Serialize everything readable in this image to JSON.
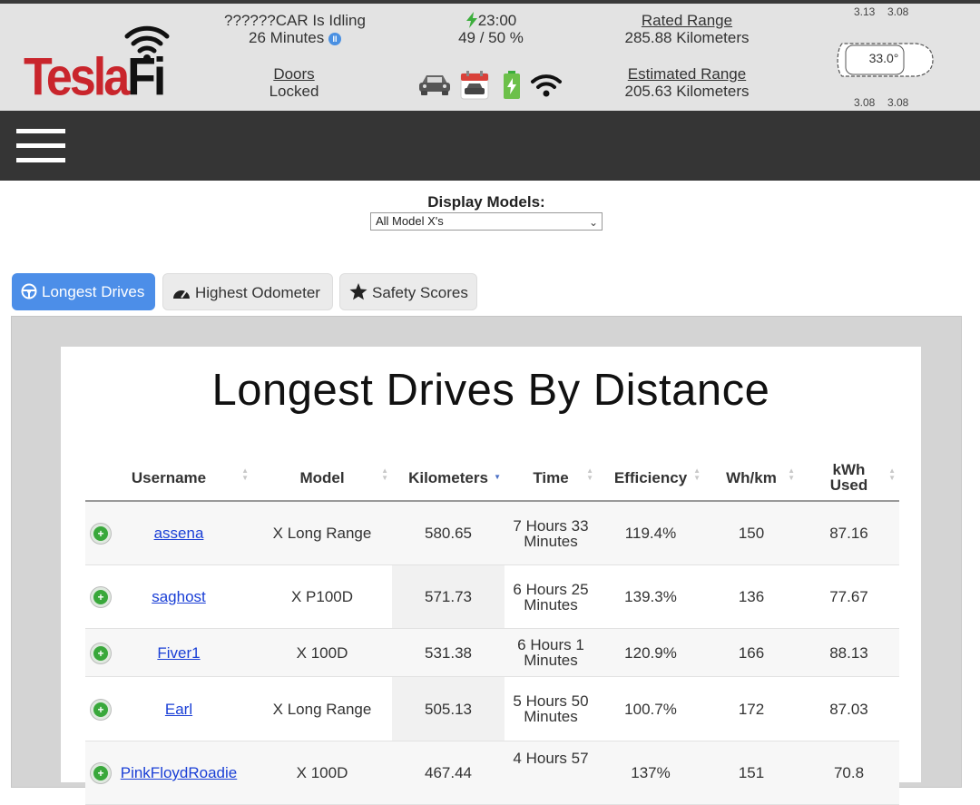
{
  "header": {
    "logo_text_tesla": "Tesla",
    "logo_text_fi": "Fi",
    "car_status": "??????CAR Is Idling",
    "idle_duration": "26 Minutes",
    "pause_symbol": "II",
    "charge_time": "23:00",
    "charge_level": "49 / 50 %",
    "rated_range_label": "Rated Range",
    "rated_range_value": "285.88 Kilometers",
    "doors_label": "Doors",
    "doors_value": "Locked",
    "estimated_range_label": "Estimated Range",
    "estimated_range_value": "205.63 Kilometers",
    "cabin_temp": "33.0°",
    "tires": {
      "front_left": "3.13",
      "front_right": "3.08",
      "rear_left": "3.08",
      "rear_right": "3.08"
    }
  },
  "display_models": {
    "label": "Display Models:",
    "selected": "All Model X's"
  },
  "tabs": [
    {
      "label": "Longest Drives",
      "icon": "steering-wheel-icon",
      "active": true
    },
    {
      "label": "Highest Odometer",
      "icon": "speedometer-icon",
      "active": false
    },
    {
      "label": "Safety Scores",
      "icon": "star-icon",
      "active": false
    }
  ],
  "panel": {
    "title": "Longest Drives By Distance"
  },
  "table": {
    "columns": [
      {
        "label": "Username"
      },
      {
        "label": "Model"
      },
      {
        "label": "Kilometers",
        "sorted": "desc"
      },
      {
        "label": "Time"
      },
      {
        "label": "Efficiency"
      },
      {
        "label": "Wh/km"
      },
      {
        "label": "kWh Used"
      }
    ],
    "rows": [
      {
        "username": "assena",
        "model": "X Long Range",
        "km": "580.65",
        "time": "7 Hours 33 Minutes",
        "efficiency": "119.4%",
        "whkm": "150",
        "kwh": "87.16"
      },
      {
        "username": "saghost",
        "model": "X P100D",
        "km": "571.73",
        "time": "6 Hours 25 Minutes",
        "efficiency": "139.3%",
        "whkm": "136",
        "kwh": "77.67"
      },
      {
        "username": "Fiver1",
        "model": "X 100D",
        "km": "531.38",
        "time": "6 Hours 1 Minutes",
        "efficiency": "120.9%",
        "whkm": "166",
        "kwh": "88.13"
      },
      {
        "username": "Earl",
        "model": "X Long Range",
        "km": "505.13",
        "time": "5 Hours 50 Minutes",
        "efficiency": "100.7%",
        "whkm": "172",
        "kwh": "87.03"
      },
      {
        "username": "PinkFloydRoadie",
        "model": "X 100D",
        "km": "467.44",
        "time": "4 Hours 57",
        "efficiency": "137%",
        "whkm": "151",
        "kwh": "70.8"
      }
    ]
  },
  "colors": {
    "tesla_red": "#c9252c",
    "active_tab": "#4c8ee8",
    "nav_bg": "#353535",
    "charge_green": "#3cae3c",
    "link_blue": "#1a3fd6"
  }
}
